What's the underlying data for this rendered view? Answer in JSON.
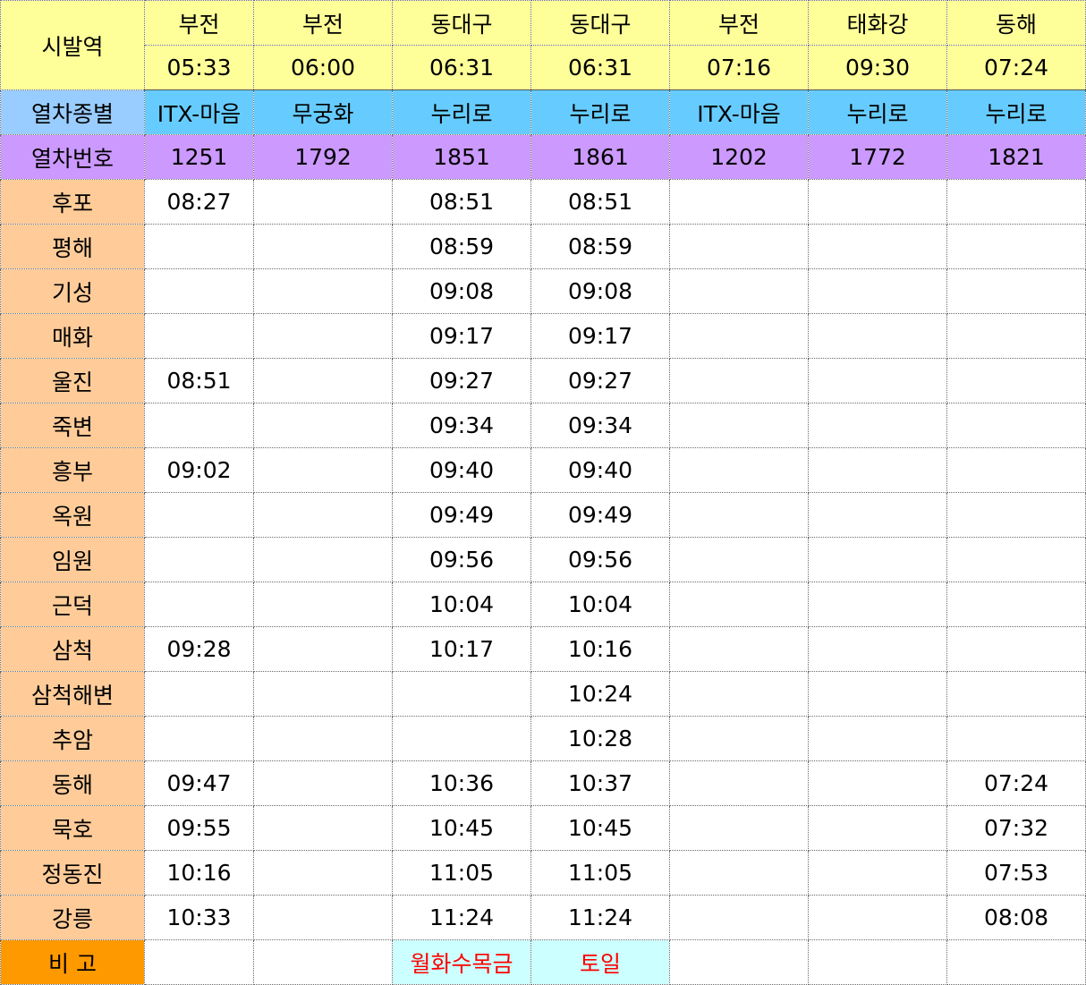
{
  "header": {
    "origin_label": "시발역",
    "type_label": "열차종별",
    "number_label": "열차번호",
    "remark_label": "비 고"
  },
  "trains": [
    {
      "origin": "부전",
      "dep": "05:33",
      "type": "ITX-마음",
      "number": "1251"
    },
    {
      "origin": "부전",
      "dep": "06:00",
      "type": "무궁화",
      "number": "1792"
    },
    {
      "origin": "동대구",
      "dep": "06:31",
      "type": "누리로",
      "number": "1851"
    },
    {
      "origin": "동대구",
      "dep": "06:31",
      "type": "누리로",
      "number": "1861"
    },
    {
      "origin": "부전",
      "dep": "07:16",
      "type": "ITX-마음",
      "number": "1202"
    },
    {
      "origin": "태화강",
      "dep": "09:30",
      "type": "누리로",
      "number": "1772"
    },
    {
      "origin": "동해",
      "dep": "07:24",
      "type": "누리로",
      "number": "1821"
    }
  ],
  "stations": [
    {
      "name": "후포",
      "times": [
        "08:27",
        "",
        "08:51",
        "08:51",
        "",
        "",
        ""
      ]
    },
    {
      "name": "평해",
      "times": [
        "",
        "",
        "08:59",
        "08:59",
        "",
        "",
        ""
      ]
    },
    {
      "name": "기성",
      "times": [
        "",
        "",
        "09:08",
        "09:08",
        "",
        "",
        ""
      ]
    },
    {
      "name": "매화",
      "times": [
        "",
        "",
        "09:17",
        "09:17",
        "",
        "",
        ""
      ]
    },
    {
      "name": "울진",
      "times": [
        "08:51",
        "",
        "09:27",
        "09:27",
        "",
        "",
        ""
      ]
    },
    {
      "name": "죽변",
      "times": [
        "",
        "",
        "09:34",
        "09:34",
        "",
        "",
        ""
      ]
    },
    {
      "name": "흥부",
      "times": [
        "09:02",
        "",
        "09:40",
        "09:40",
        "",
        "",
        ""
      ]
    },
    {
      "name": "옥원",
      "times": [
        "",
        "",
        "09:49",
        "09:49",
        "",
        "",
        ""
      ]
    },
    {
      "name": "임원",
      "times": [
        "",
        "",
        "09:56",
        "09:56",
        "",
        "",
        ""
      ]
    },
    {
      "name": "근덕",
      "times": [
        "",
        "",
        "10:04",
        "10:04",
        "",
        "",
        ""
      ]
    },
    {
      "name": "삼척",
      "times": [
        "09:28",
        "",
        "10:17",
        "10:16",
        "",
        "",
        ""
      ]
    },
    {
      "name": "삼척해변",
      "times": [
        "",
        "",
        "",
        "10:24",
        "",
        "",
        ""
      ]
    },
    {
      "name": "추암",
      "times": [
        "",
        "",
        "",
        "10:28",
        "",
        "",
        ""
      ]
    },
    {
      "name": "동해",
      "times": [
        "09:47",
        "",
        "10:36",
        "10:37",
        "",
        "",
        "07:24"
      ]
    },
    {
      "name": "묵호",
      "times": [
        "09:55",
        "",
        "10:45",
        "10:45",
        "",
        "",
        "07:32"
      ]
    },
    {
      "name": "정동진",
      "times": [
        "10:16",
        "",
        "11:05",
        "11:05",
        "",
        "",
        "07:53"
      ]
    },
    {
      "name": "강릉",
      "times": [
        "10:33",
        "",
        "11:24",
        "11:24",
        "",
        "",
        "08:08"
      ]
    }
  ],
  "remarks": [
    "",
    "",
    "월화수목금",
    "토일",
    "",
    "",
    ""
  ],
  "colors": {
    "header_yellow": "#ffff99",
    "type_label_bg": "#99ccff",
    "type_row_bg": "#66ccff",
    "number_row_bg": "#cc99ff",
    "station_bg": "#ffcc99",
    "remark_label_bg": "#ff9900",
    "remark_note_bg": "#ccffff",
    "remark_text": "#ff0000"
  }
}
